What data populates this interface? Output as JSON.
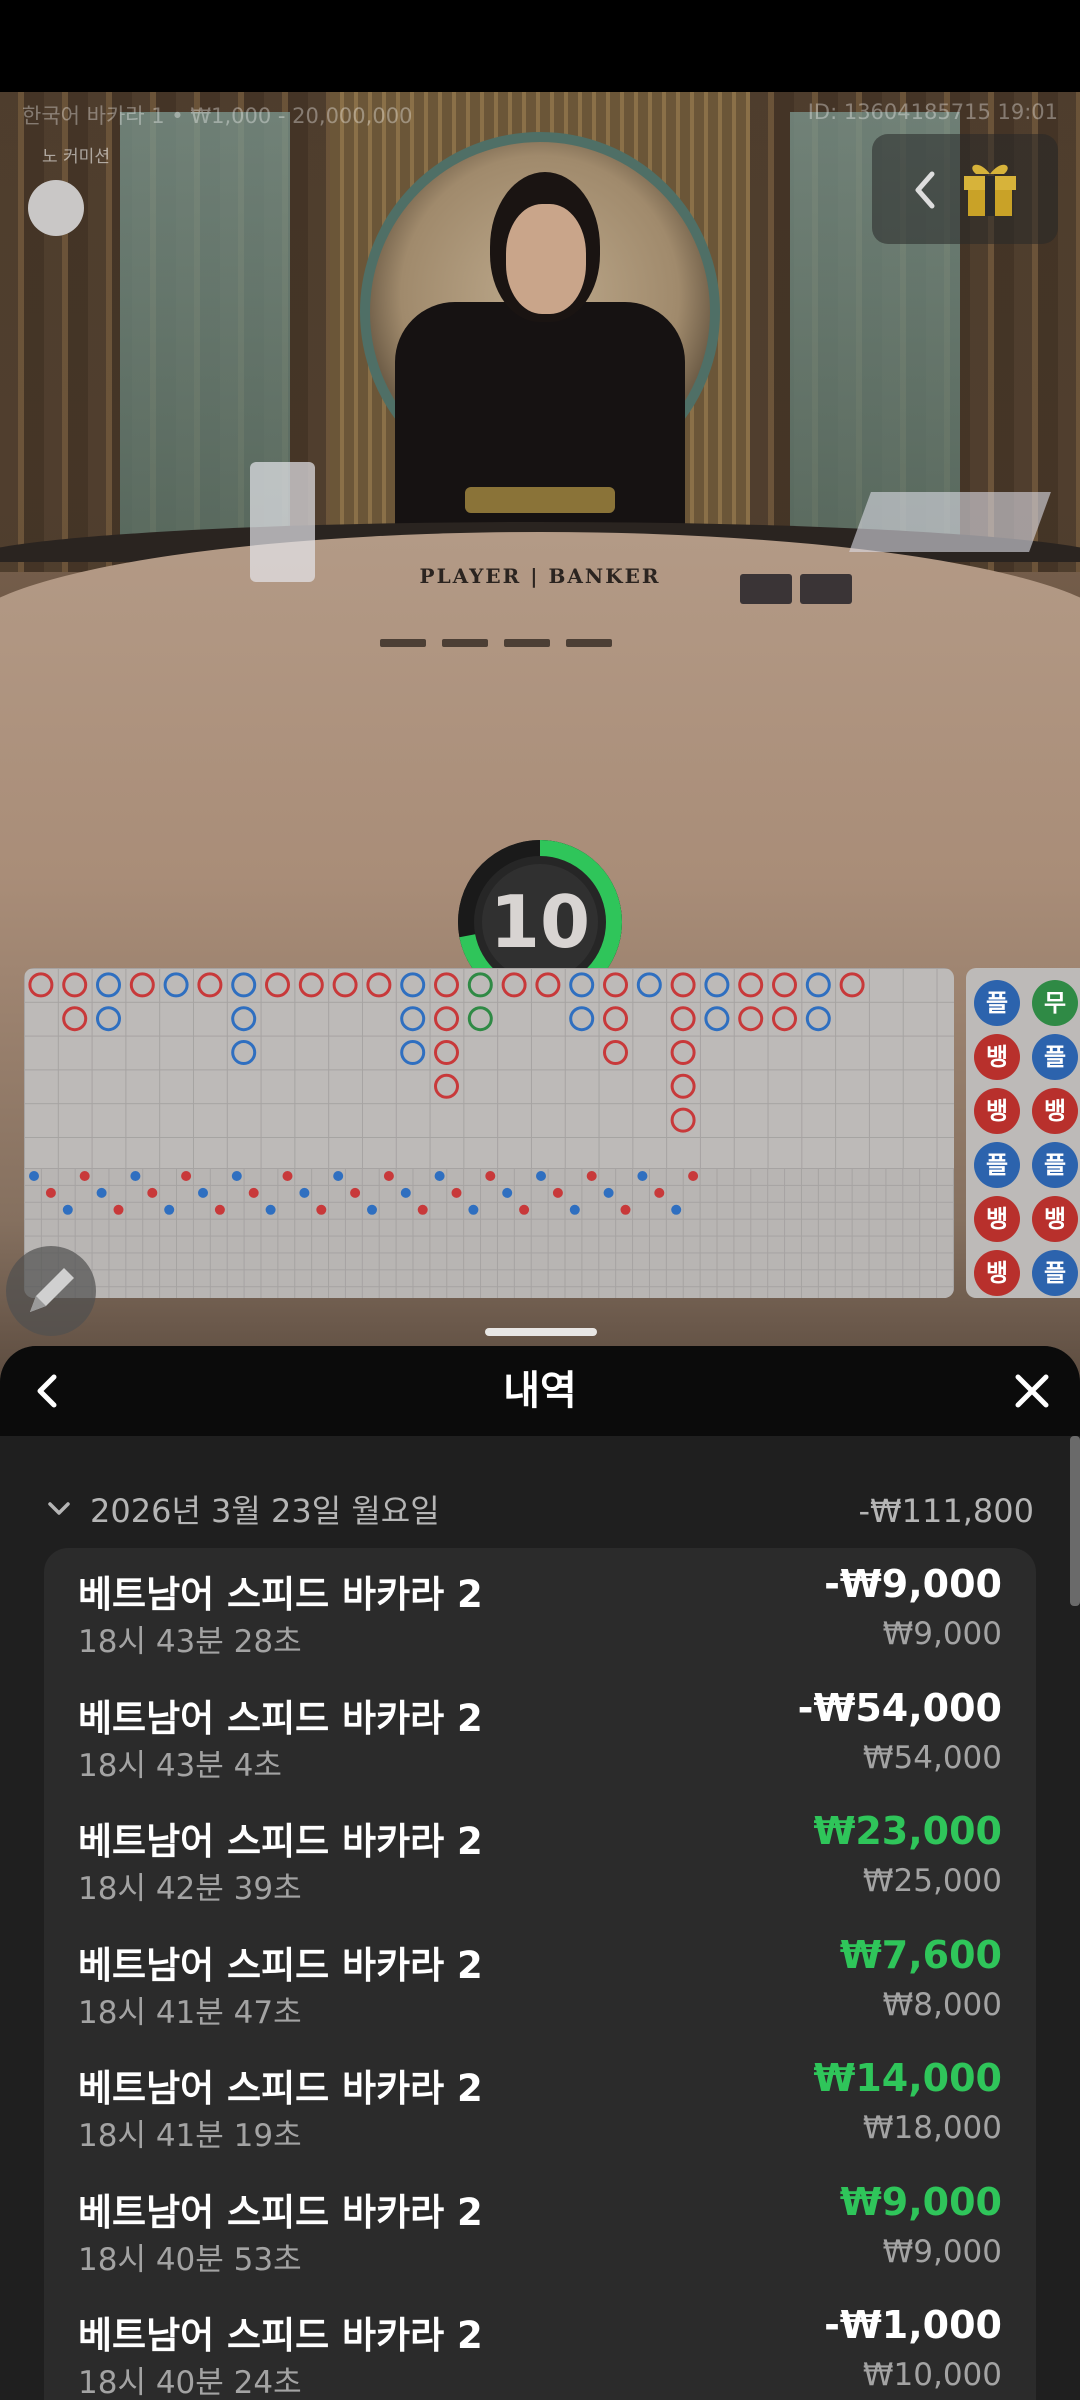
{
  "game_info": {
    "table_name_limits": "한국어 바카라 1 • ₩1,000 - 20,000,000",
    "no_commission": "노 커미션",
    "round_id": "ID: 13604185715 19:01"
  },
  "table_surface_label": "PLAYER | BANKER",
  "timer": {
    "seconds": "10",
    "progress": 0.72
  },
  "colors": {
    "accent_green": "#2fc55a",
    "player_blue": "#2c63ad",
    "banker_red": "#b8302c",
    "tie_green": "#2f8a45"
  },
  "bead_road": {
    "rows": [
      [
        {
          "label": "플",
          "type": "p"
        },
        {
          "label": "무",
          "type": "t"
        }
      ],
      [
        {
          "label": "뱅",
          "type": "b"
        },
        {
          "label": "플",
          "type": "p"
        }
      ],
      [
        {
          "label": "뱅",
          "type": "b"
        },
        {
          "label": "뱅",
          "type": "b"
        }
      ],
      [
        {
          "label": "플",
          "type": "p"
        },
        {
          "label": "플",
          "type": "p"
        }
      ],
      [
        {
          "label": "뱅",
          "type": "b"
        },
        {
          "label": "뱅",
          "type": "b"
        }
      ],
      [
        {
          "label": "뱅",
          "type": "b"
        },
        {
          "label": "플",
          "type": "p"
        }
      ]
    ]
  },
  "history": {
    "title": "내역",
    "date_label": "2026년 3월 23일 월요일",
    "date_total": "-₩111,800",
    "items": [
      {
        "name": "베트남어 스피드 바카라 2",
        "time": "18시 43분 28초",
        "amount": "-₩9,000",
        "stake": "₩9,000",
        "win": false
      },
      {
        "name": "베트남어 스피드 바카라 2",
        "time": "18시 43분 4초",
        "amount": "-₩54,000",
        "stake": "₩54,000",
        "win": false
      },
      {
        "name": "베트남어 스피드 바카라 2",
        "time": "18시 42분 39초",
        "amount": "₩23,000",
        "stake": "₩25,000",
        "win": true
      },
      {
        "name": "베트남어 스피드 바카라 2",
        "time": "18시 41분 47초",
        "amount": "₩7,600",
        "stake": "₩8,000",
        "win": true
      },
      {
        "name": "베트남어 스피드 바카라 2",
        "time": "18시 41분 19초",
        "amount": "₩14,000",
        "stake": "₩18,000",
        "win": true
      },
      {
        "name": "베트남어 스피드 바카라 2",
        "time": "18시 40분 53초",
        "amount": "₩9,000",
        "stake": "₩9,000",
        "win": true
      },
      {
        "name": "베트남어 스피드 바카라 2",
        "time": "18시 40분 24초",
        "amount": "-₩1,000",
        "stake": "₩10,000",
        "win": false
      }
    ]
  },
  "icons": {
    "back": "chevron-left-icon",
    "close": "close-icon",
    "gift": "gift-icon",
    "date_toggle": "chevron-down-icon",
    "pen": "pen-icon"
  }
}
